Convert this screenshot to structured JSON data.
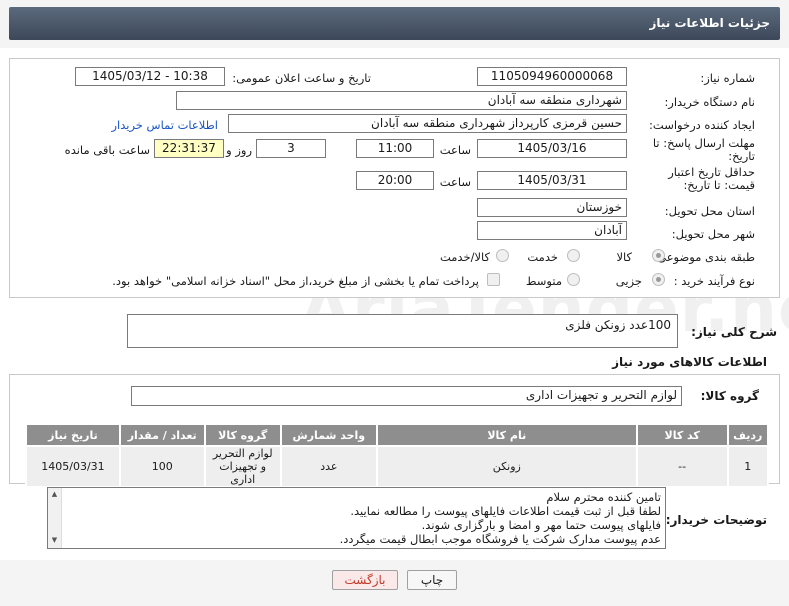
{
  "header": {
    "title": "جزئیات اطلاعات نیاز"
  },
  "form": {
    "need_number_label": "شماره نیاز:",
    "need_number": "1105094960000068",
    "announce_label": "تاریخ و ساعت اعلان عمومی:",
    "announce_value": "1405/03/12 - 10:38",
    "buyer_org_label": "نام دستگاه خریدار:",
    "buyer_org": "شهرداری منطقه سه آبادان",
    "creator_label": "ایجاد کننده درخواست:",
    "creator": "حسین قرمزی کارپرداز شهرداری منطقه سه آبادان",
    "contact_link": "اطلاعات تماس خریدار",
    "reply_deadline_label": "مهلت ارسال پاسخ: تا تاریخ:",
    "reply_date": "1405/03/16",
    "time_label": "ساعت",
    "reply_time": "11:00",
    "days_value": "3",
    "days_label": "روز و",
    "remaining_time": "22:31:37",
    "remaining_label": "ساعت باقی مانده",
    "validity_label": "حداقل تاریخ اعتبار قیمت: تا تاریخ:",
    "validity_date": "1405/03/31",
    "validity_time": "20:00",
    "province_label": "استان محل تحویل:",
    "province": "خوزستان",
    "city_label": "شهر محل تحویل:",
    "city": "آبادان",
    "category_label": "طبقه بندی موضوعی:",
    "category_options": [
      "کالا",
      "خدمت",
      "کالا/خدمت"
    ],
    "purchase_type_label": "نوع فرآیند خرید :",
    "purchase_options": [
      "جزیی",
      "متوسط"
    ],
    "payment_note": "پرداخت تمام یا بخشی از مبلغ خرید،از محل \"اسناد خزانه اسلامی\" خواهد بود."
  },
  "summary": {
    "label": "شرح کلی نیاز:",
    "value": "100عدد زونکن فلزی"
  },
  "goods": {
    "section_title": "اطلاعات کالاهای مورد نیاز",
    "group_label": "گروه کالا:",
    "group_value": "لوازم التحریر و تجهیزات اداری",
    "columns": [
      "ردیف",
      "کد کالا",
      "نام کالا",
      "واحد شمارش",
      "گروه کالا",
      "تعداد / مقدار",
      "تاریخ نیاز"
    ],
    "rows": [
      {
        "row": "1",
        "code": "--",
        "name": "زونکن",
        "unit": "عدد",
        "group": "لوازم التحریر و تجهیزات اداری",
        "qty": "100",
        "date": "1405/03/31"
      }
    ]
  },
  "buyer_notes": {
    "label": "توضیحات خریدار:",
    "lines": [
      "تامین کننده محترم سلام",
      "لطفا قبل از ثبت قیمت اطلاعات فایلهای پیوست را مطالعه نمایید.",
      "فایلهای پیوست حتما مهر و امضا و بارگزاری شوند.",
      "عدم پیوست مدارک شرکت یا فروشگاه موجب ابطال قیمت میگردد."
    ]
  },
  "actions": {
    "print": "چاپ",
    "back": "بازگشت"
  },
  "watermark": {
    "text": "AriaTender.net"
  },
  "colors": {
    "header": "#4a5768",
    "link": "#1a55c4",
    "back_button_text": "#c0392b",
    "highlight": "#ffffc4"
  }
}
